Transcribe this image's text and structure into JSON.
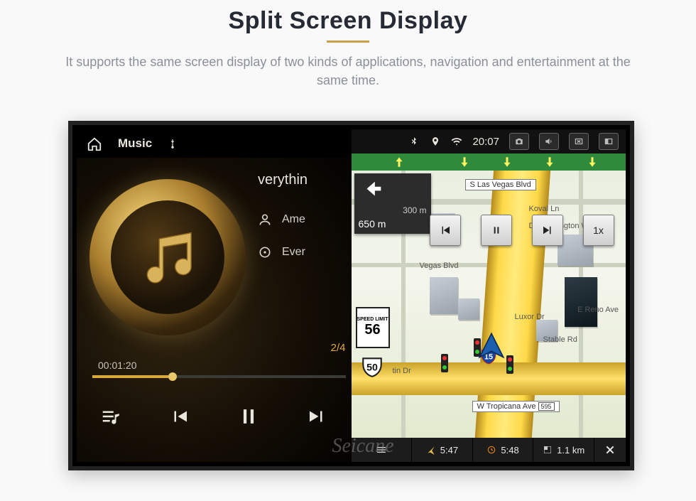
{
  "header": {
    "title": "Split Screen Display",
    "subtitle": "It supports the same screen display of two kinds of applications, navigation and entertainment at the same time."
  },
  "brand_watermark": "Seicane",
  "music": {
    "top_label": "Music",
    "track_title": "verythin",
    "artist_label": "Ame",
    "album_label": "Ever",
    "counter": "2/4",
    "time_elapsed": "00:01:20",
    "time_remaining_placeholder": ""
  },
  "statusbar": {
    "clock": "20:07"
  },
  "nav": {
    "turn_distance_primary": "300 m",
    "turn_distance_secondary": "650 m",
    "speed_limit_label": "SPEED LIMIT",
    "speed_limit_value": "56",
    "route_shield": "50",
    "interstate_shield": "15",
    "speed_multiplier": "1x",
    "streets": {
      "top": "S Las Vegas Blvd",
      "koval": "Koval Ln",
      "duke": "Duke Ellington Way",
      "vegas_blvd": "Vegas Blvd",
      "luxor": "Luxor Dr",
      "reno": "E Reno Ave",
      "stable": "Stable Rd",
      "tin": "tin Dr",
      "tropicana": "W Tropicana Ave",
      "tropicana_no": "595"
    },
    "bottom": {
      "eta": "5:47",
      "clock": "5:48",
      "dist": "1.1 km"
    }
  }
}
